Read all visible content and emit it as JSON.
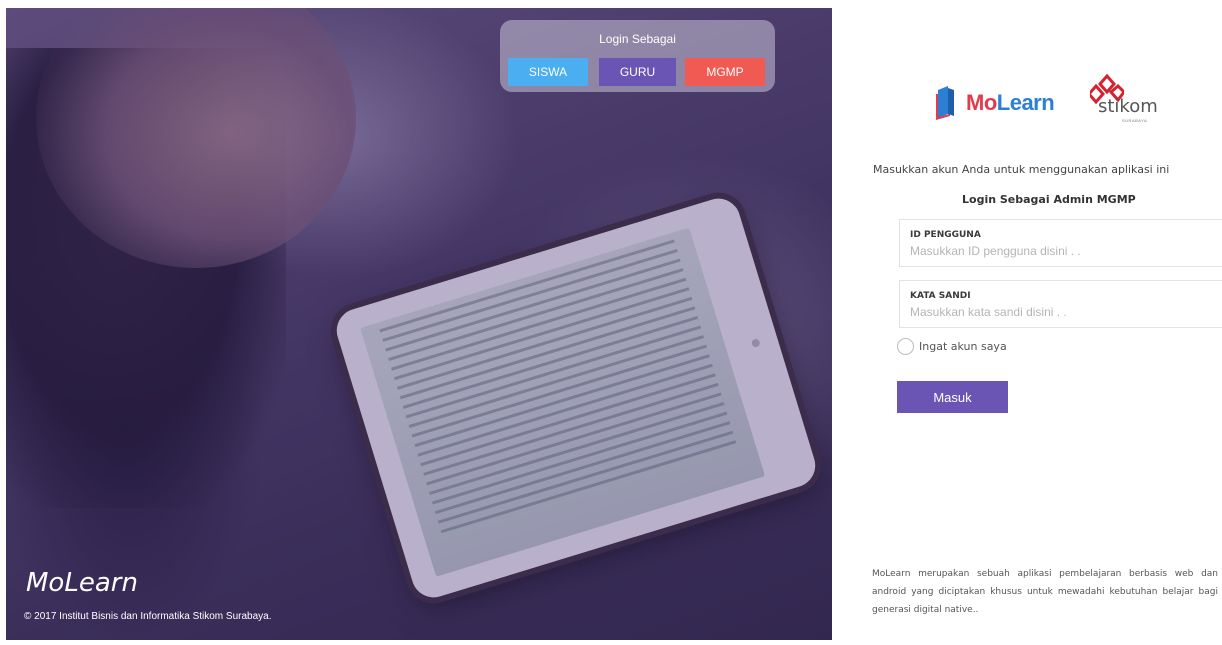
{
  "hero": {
    "role_panel": {
      "title": "Login Sebagai",
      "buttons": [
        {
          "label": "SISWA",
          "color": "#4aaef0"
        },
        {
          "label": "GURU",
          "color": "#6a55b5"
        },
        {
          "label": "MGMP",
          "color": "#f05a52"
        }
      ]
    },
    "brand": "MoLearn",
    "copyright": "© 2017 Institut Bisnis dan Informatika Stikom Surabaya."
  },
  "logos": {
    "molearn": {
      "part1": "Mo",
      "part2": "Learn"
    },
    "stikom": {
      "word": "stikom",
      "sub": "SURABAYA"
    }
  },
  "form": {
    "instruction": "Masukkan akun Anda untuk menggunakan aplikasi ini",
    "login_as": "Login Sebagai Admin MGMP",
    "id_field": {
      "label": "ID PENGGUNA",
      "placeholder": "Masukkan ID pengguna disini . .",
      "value": ""
    },
    "password_field": {
      "label": "KATA SANDI",
      "placeholder": "Masukkan kata sandi disini . .",
      "value": ""
    },
    "remember_label": "Ingat akun saya",
    "remember_checked": false,
    "submit_label": "Masuk",
    "accent_color": "#6a55b5"
  },
  "about": "MoLearn merupakan sebuah aplikasi pembelajaran berbasis web dan android yang diciptakan khusus untuk mewadahi kebutuhan belajar bagi generasi digital native.."
}
